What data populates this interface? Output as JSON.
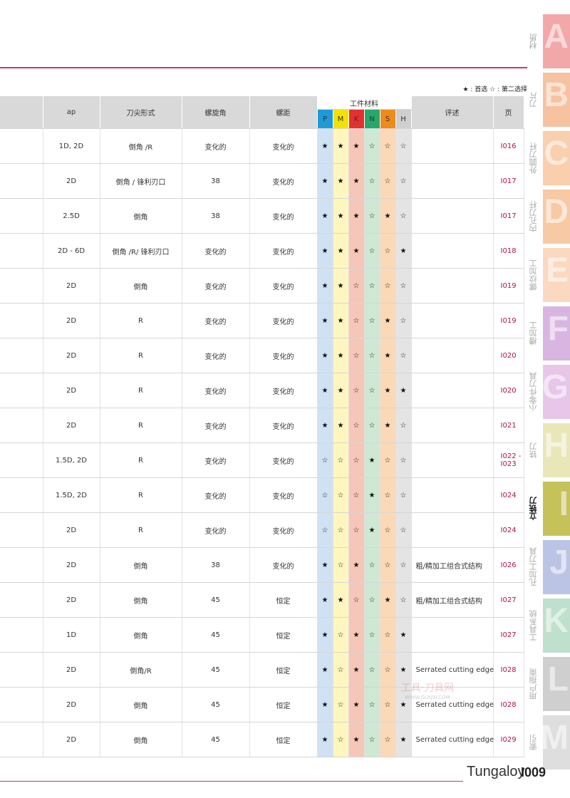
{
  "legend": "★ : 首选   ☆ : 第二选择",
  "table": {
    "headers": {
      "ap": "ap",
      "tip": "刀尖形式",
      "helix": "螺旋角",
      "pitch": "螺距",
      "material": "工件材料",
      "comment": "评述",
      "page": "页"
    },
    "materials": [
      "P",
      "M",
      "K",
      "N",
      "S",
      "H"
    ],
    "rows": [
      {
        "ap": "1D, 2D",
        "tip": "倒角 /R",
        "helix": "变化的",
        "pitch": "变化的",
        "m": [
          "★",
          "★",
          "★",
          "☆",
          "☆",
          "☆"
        ],
        "comment": "",
        "page": "I016"
      },
      {
        "ap": "2D",
        "tip": "倒角 / 锋利刃口",
        "helix": "38",
        "pitch": "变化的",
        "m": [
          "★",
          "★",
          "★",
          "☆",
          "☆",
          "☆"
        ],
        "comment": "",
        "page": "I017"
      },
      {
        "ap": "2.5D",
        "tip": "倒角",
        "helix": "38",
        "pitch": "变化的",
        "m": [
          "★",
          "★",
          "★",
          "☆",
          "★",
          "☆"
        ],
        "comment": "",
        "page": "I017"
      },
      {
        "ap": "2D - 6D",
        "tip": "倒角 /R/ 锋利刃口",
        "helix": "变化的",
        "pitch": "变化的",
        "m": [
          "★",
          "★",
          "★",
          "☆",
          "☆",
          "★"
        ],
        "comment": "",
        "page": "I018"
      },
      {
        "ap": "2D",
        "tip": "倒角",
        "helix": "变化的",
        "pitch": "变化的",
        "m": [
          "★",
          "★",
          "☆",
          "☆",
          "☆",
          "☆"
        ],
        "comment": "",
        "page": "I019"
      },
      {
        "ap": "2D",
        "tip": "R",
        "helix": "变化的",
        "pitch": "变化的",
        "m": [
          "★",
          "★",
          "☆",
          "☆",
          "★",
          "☆"
        ],
        "comment": "",
        "page": "I019"
      },
      {
        "ap": "2D",
        "tip": "R",
        "helix": "变化的",
        "pitch": "变化的",
        "m": [
          "★",
          "★",
          "☆",
          "☆",
          "★",
          "☆"
        ],
        "comment": "",
        "page": "I020"
      },
      {
        "ap": "2D",
        "tip": "R",
        "helix": "变化的",
        "pitch": "变化的",
        "m": [
          "★",
          "★",
          "☆",
          "☆",
          "★",
          "★"
        ],
        "comment": "",
        "page": "I020"
      },
      {
        "ap": "2D",
        "tip": "R",
        "helix": "变化的",
        "pitch": "变化的",
        "m": [
          "★",
          "★",
          "☆",
          "☆",
          "★",
          "☆"
        ],
        "comment": "",
        "page": "I021"
      },
      {
        "ap": "1.5D, 2D",
        "tip": "R",
        "helix": "变化的",
        "pitch": "变化的",
        "m": [
          "☆",
          "☆",
          "☆",
          "★",
          "☆",
          "☆"
        ],
        "comment": "",
        "page": "I022 - I023"
      },
      {
        "ap": "1.5D, 2D",
        "tip": "R",
        "helix": "变化的",
        "pitch": "变化的",
        "m": [
          "☆",
          "☆",
          "☆",
          "★",
          "☆",
          "☆"
        ],
        "comment": "",
        "page": "I024"
      },
      {
        "ap": "2D",
        "tip": "R",
        "helix": "变化的",
        "pitch": "变化的",
        "m": [
          "☆",
          "☆",
          "☆",
          "★",
          "☆",
          "☆"
        ],
        "comment": "",
        "page": "I024"
      },
      {
        "ap": "2D",
        "tip": "倒角",
        "helix": "38",
        "pitch": "变化的",
        "m": [
          "★",
          "☆",
          "★",
          "☆",
          "☆",
          "☆"
        ],
        "comment": "粗/精加工组合式结构",
        "page": "I026"
      },
      {
        "ap": "2D",
        "tip": "倒角",
        "helix": "45",
        "pitch": "恒定",
        "m": [
          "★",
          "★",
          "☆",
          "☆",
          "★",
          "☆"
        ],
        "comment": "粗/精加工组合式结构",
        "page": "I027"
      },
      {
        "ap": "1D",
        "tip": "倒角",
        "helix": "45",
        "pitch": "恒定",
        "m": [
          "★",
          "☆",
          "★",
          "☆",
          "☆",
          "★"
        ],
        "comment": "",
        "page": "I027"
      },
      {
        "ap": "2D",
        "tip": "倒角/R",
        "helix": "45",
        "pitch": "恒定",
        "m": [
          "★",
          "☆",
          "★",
          "☆",
          "☆",
          "★"
        ],
        "comment": "Serrated cutting edge",
        "page": "I028"
      },
      {
        "ap": "2D",
        "tip": "倒角",
        "helix": "45",
        "pitch": "恒定",
        "m": [
          "★",
          "☆",
          "★",
          "☆",
          "☆",
          "★"
        ],
        "comment": "Serrated cutting edge",
        "page": "I028"
      },
      {
        "ap": "2D",
        "tip": "倒角",
        "helix": "45",
        "pitch": "恒定",
        "m": [
          "★",
          "☆",
          "★",
          "☆",
          "☆",
          "★"
        ],
        "comment": "Serrated cutting edge",
        "page": "I029"
      }
    ]
  },
  "tabs": [
    {
      "letter": "A",
      "label": "材质",
      "color": "#f2a8a8"
    },
    {
      "letter": "B",
      "label": "刀片",
      "color": "#f7c2a0"
    },
    {
      "letter": "C",
      "label": "外圆刀杆",
      "color": "#f9cfae"
    },
    {
      "letter": "D",
      "label": "内孔刀杆",
      "color": "#f7c9a5"
    },
    {
      "letter": "E",
      "label": "螺纹加工",
      "color": "#fbd9c0"
    },
    {
      "letter": "F",
      "label": "槽加工",
      "color": "#d9b6e2"
    },
    {
      "letter": "G",
      "label": "小零件刀具",
      "color": "#e7c6ea"
    },
    {
      "letter": "H",
      "label": "铣刀",
      "color": "#e9e7b8"
    },
    {
      "letter": "I",
      "label": "立铣刀",
      "color": "#c5c25a",
      "active": true
    },
    {
      "letter": "J",
      "label": "孔加工刀具",
      "color": "#bcc4e6"
    },
    {
      "letter": "K",
      "label": "工具系统",
      "color": "#bfe0cc"
    },
    {
      "letter": "L",
      "label": "用户指南",
      "color": "#cfcfcf"
    },
    {
      "letter": "M",
      "label": "索引",
      "color": "#dedede"
    }
  ],
  "footer": {
    "brand": "Tungaloy",
    "page": "I009"
  },
  "watermark": {
    "text": "工具·刀具网",
    "url": "WWW.GLRJW.COM"
  }
}
